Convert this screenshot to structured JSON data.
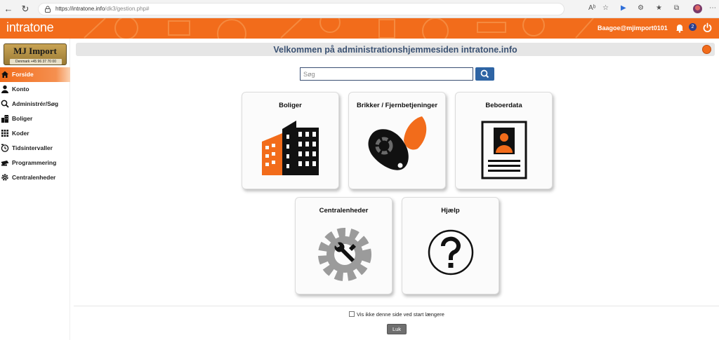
{
  "browser": {
    "url_host": "https://intratone.info",
    "url_path": "/dk3/gestion.php#"
  },
  "header": {
    "brand": "intratone",
    "user": "Baagoe@mjimport0101",
    "notification_count": "2",
    "accent_color": "#f26c1b"
  },
  "sidebar": {
    "logo_name": "MJ Import",
    "logo_tag": "Denmark +45 96 37 70 00",
    "items": [
      {
        "label": "Forside",
        "icon": "home-icon",
        "active": true
      },
      {
        "label": "Konto",
        "icon": "user-icon"
      },
      {
        "label": "Administrér/Søg",
        "icon": "search-icon"
      },
      {
        "label": "Boliger",
        "icon": "buildings-icon"
      },
      {
        "label": "Koder",
        "icon": "keypad-icon"
      },
      {
        "label": "Tidsintervaller",
        "icon": "clock-icon"
      },
      {
        "label": "Programmering",
        "icon": "programmer-icon"
      },
      {
        "label": "Centralenheder",
        "icon": "gear-icon"
      }
    ]
  },
  "main": {
    "title": "Velkommen på administrationshjemmesiden intratone.info",
    "search_placeholder": "Søg",
    "tiles": [
      {
        "label": "Boliger",
        "icon": "buildings-icon"
      },
      {
        "label": "Brikker / Fjernbetjeninger",
        "icon": "key-fob-icon"
      },
      {
        "label": "Beboerdata",
        "icon": "resident-card-icon"
      },
      {
        "label": "Centralenheder",
        "icon": "gear-wrench-icon"
      },
      {
        "label": "Hjælp",
        "icon": "question-icon"
      }
    ],
    "checkbox_label": "Vis ikke denne side ved start længere",
    "close_label": "Luk"
  }
}
